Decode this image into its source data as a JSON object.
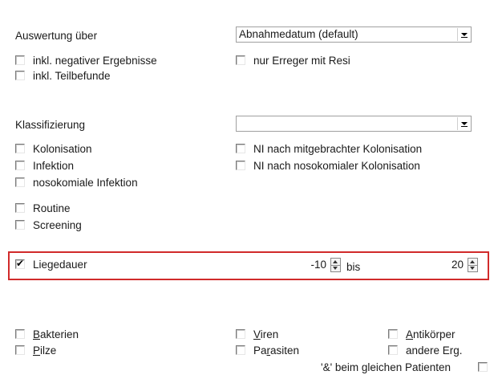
{
  "auswertung": {
    "label": "Auswertung über",
    "select_value": "Abnahmedatum (default)"
  },
  "auswertung_options": [
    {
      "label": "inkl. negativer Ergebnisse",
      "checked": false
    },
    {
      "label": "inkl. Teilbefunde",
      "checked": false
    },
    {
      "label": "nur Erreger mit Resi",
      "checked": false
    }
  ],
  "klassifizierung": {
    "label": "Klassifizierung",
    "select_value": ""
  },
  "klass_left": [
    {
      "label": "Kolonisation",
      "checked": false
    },
    {
      "label": "Infektion",
      "checked": false
    },
    {
      "label": "nosokomiale Infektion",
      "checked": false
    },
    {
      "label": "Routine",
      "checked": false
    },
    {
      "label": "Screening",
      "checked": false
    }
  ],
  "klass_right": [
    {
      "label": "NI nach mitgebrachter Kolonisation",
      "checked": false
    },
    {
      "label": "NI nach nosokomialer Kolonisation",
      "checked": false
    }
  ],
  "liegedauer": {
    "label": "Liegedauer",
    "checked": true,
    "check_glyph": "✔",
    "from": "-10",
    "separator": "bis",
    "to": "20"
  },
  "erreger": {
    "bakterien": {
      "label_u": "B",
      "label_rest": "akterien",
      "checked": false
    },
    "pilze": {
      "label_u": "P",
      "label_rest": "ilze",
      "checked": false
    },
    "viren": {
      "label_u": "V",
      "label_rest": "iren",
      "checked": false
    },
    "parasiten": {
      "label_pre": "Pa",
      "label_u": "r",
      "label_rest": "asiten",
      "checked": false
    },
    "antikoerper": {
      "label_u": "A",
      "label_rest": "ntikörper",
      "checked": false
    },
    "andere": {
      "label": "andere Erg.",
      "checked": false
    }
  },
  "footer": {
    "label": "'&' beim gleichen Patienten"
  },
  "colors": {
    "highlight_border": "#d12b2b",
    "background": "#ffffff"
  }
}
